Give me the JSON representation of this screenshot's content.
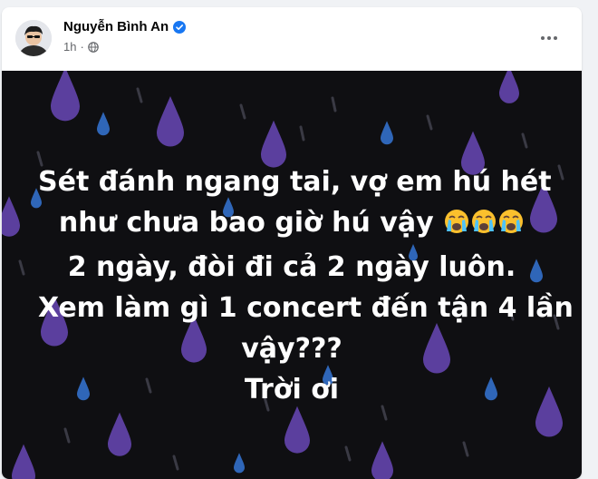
{
  "post": {
    "author": "Nguyễn Bình An",
    "time": "1h",
    "verified": true,
    "icons": [
      "verified-badge-icon",
      "globe-icon",
      "more-options-icon",
      "crying-face-emoji"
    ],
    "colors": {
      "verified_blue": "#1877f2",
      "image_background": "#0f0f12",
      "drop_purple": "#5b3f9e",
      "drop_blue": "#2f66b8"
    }
  },
  "status_image": {
    "lines": [
      "Sét đánh ngang tai, vợ em hú hét",
      "như chưa bao giờ hú vậy",
      "2 ngày, đòi đi cả 2 ngày luôn.",
      "Xem làm gì 1 concert đến tận 4 lần",
      "vậy???",
      "Trời ơi"
    ],
    "emoji_count": 3
  }
}
